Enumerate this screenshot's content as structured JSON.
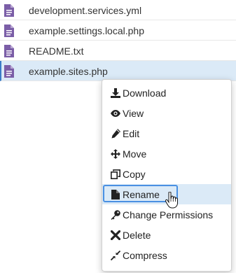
{
  "files": [
    {
      "name": "development.services.yml",
      "icon": "file-icon",
      "selected": false
    },
    {
      "name": "example.settings.local.php",
      "icon": "file-icon",
      "selected": false
    },
    {
      "name": "README.txt",
      "icon": "file-icon",
      "selected": false
    },
    {
      "name": "example.sites.php",
      "icon": "file-icon",
      "selected": true
    }
  ],
  "context_menu": {
    "items": [
      {
        "label": "Download",
        "icon": "download-icon"
      },
      {
        "label": "View",
        "icon": "eye-icon"
      },
      {
        "label": "Edit",
        "icon": "pencil-icon"
      },
      {
        "label": "Move",
        "icon": "move-arrows-icon"
      },
      {
        "label": "Copy",
        "icon": "copy-icon"
      },
      {
        "label": "Rename",
        "icon": "file-icon",
        "highlighted": true
      },
      {
        "label": "Change Permissions",
        "icon": "key-icon"
      },
      {
        "label": "Delete",
        "icon": "x-icon"
      },
      {
        "label": "Compress",
        "icon": "compress-icon"
      }
    ]
  },
  "colors": {
    "file_icon": "#7b5ea7",
    "selection_bg": "#dbeaf7",
    "focus_border": "#4a90e2"
  }
}
